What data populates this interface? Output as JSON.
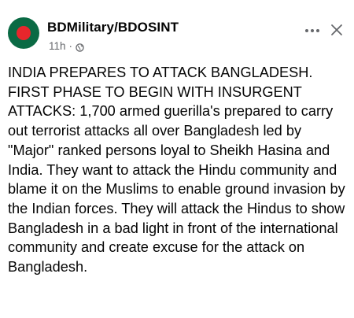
{
  "post": {
    "author": "BDMilitary/BDOSINT",
    "timestamp": "11h",
    "audience_icon": "globe-icon",
    "more_icon": "more-options-icon",
    "close_icon": "close-icon",
    "avatar_colors": {
      "field": "#0a6a44",
      "disc": "#e7262c"
    },
    "text": "INDIA PREPARES TO ATTACK BANGLADESH. FIRST PHASE TO BEGIN WITH INSURGENT ATTACKS: 1,700 armed guerilla's prepared to carry out terrorist attacks all over Bangladesh led by \"Major\" ranked persons loyal to Sheikh Hasina and India. They want to attack the Hindu community and blame it on the Muslims to enable ground invasion by the Indian forces. They will attack the Hindus to show Bangladesh in a bad light in front of the international community and create excuse for the attack on Bangladesh."
  }
}
